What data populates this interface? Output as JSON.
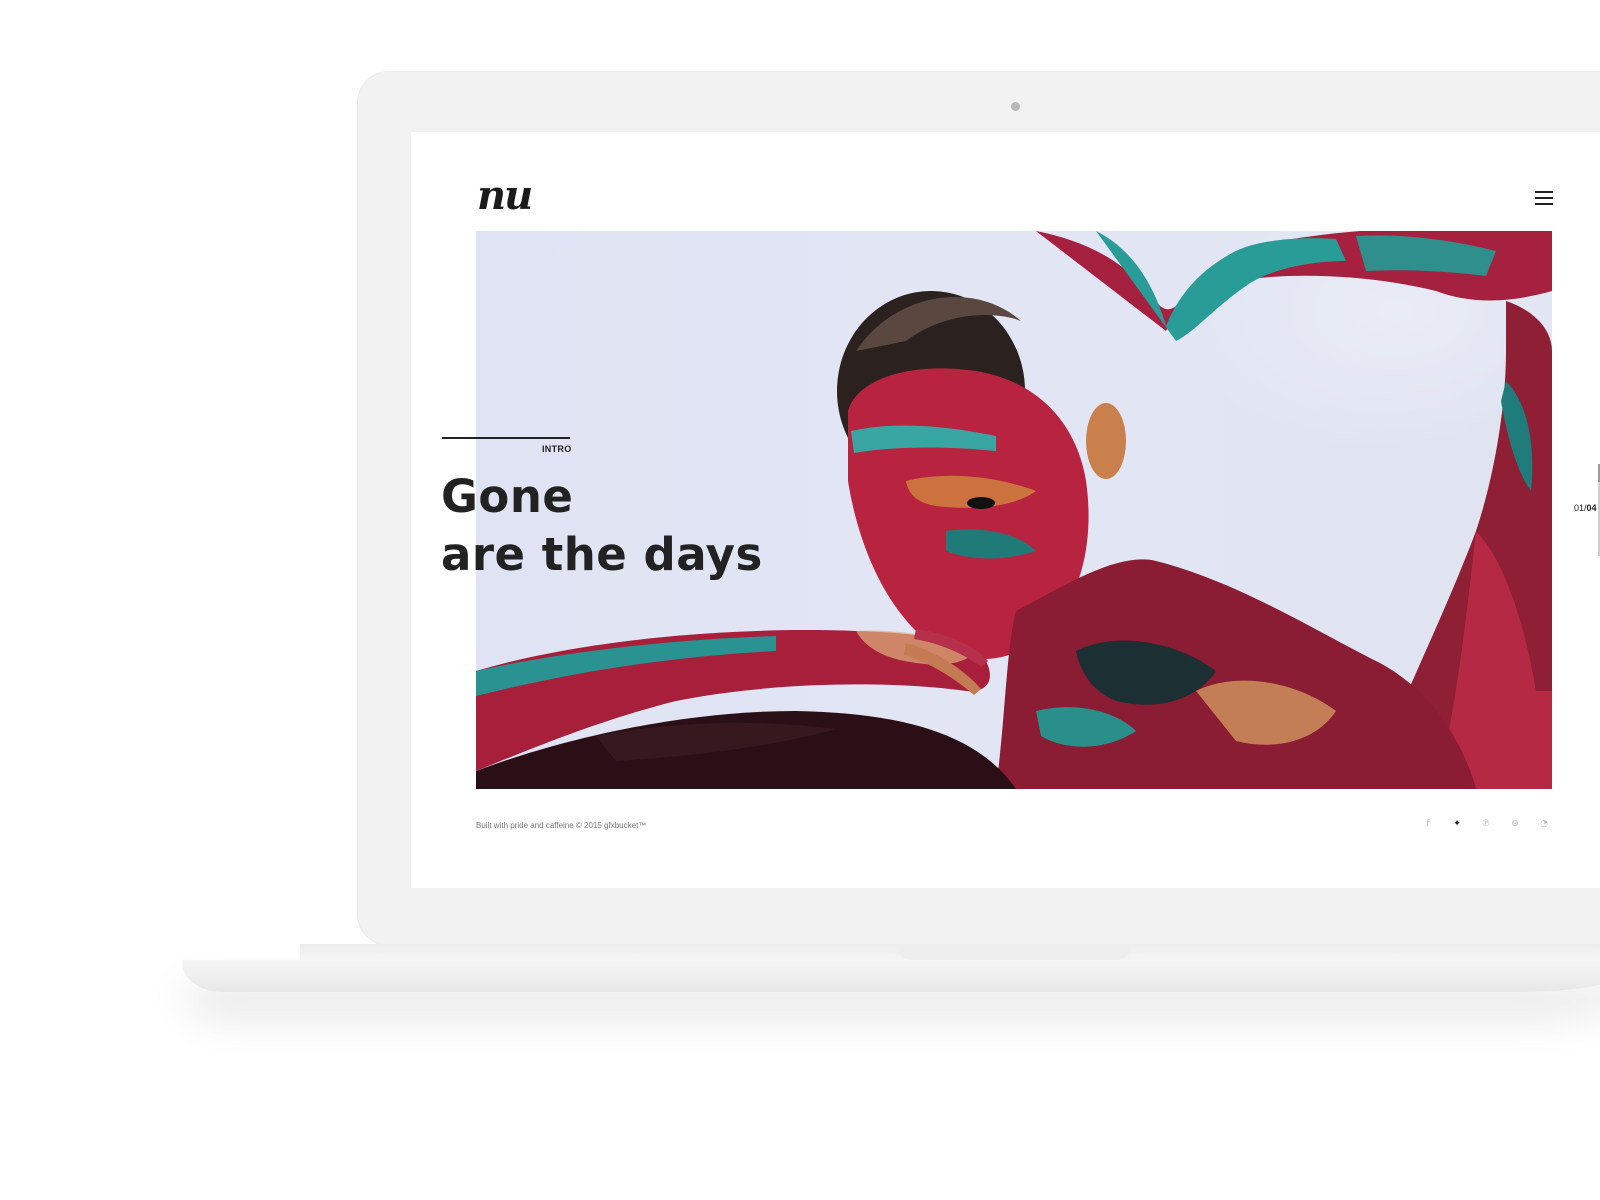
{
  "site": {
    "logo": "nu"
  },
  "hero": {
    "label": "INTRO",
    "headline_line1": "Gone",
    "headline_line2": "are the days"
  },
  "slider": {
    "current": "01",
    "separator": "/",
    "total": "04"
  },
  "footer": {
    "credit": "Built with pride and caffeine © 2015 gfxbucket™",
    "social": [
      {
        "name": "facebook-icon",
        "glyph": "f"
      },
      {
        "name": "twitter-icon",
        "glyph": "✦"
      },
      {
        "name": "pinterest-icon",
        "glyph": "℗"
      },
      {
        "name": "dribbble-icon",
        "glyph": "⊛"
      },
      {
        "name": "rss-icon",
        "glyph": "◔"
      }
    ]
  },
  "colors": {
    "text_dark": "#222222",
    "hero_background": "#dfe3f3",
    "paint_red": "#b51e3c",
    "paint_teal": "#1f8c8a"
  }
}
